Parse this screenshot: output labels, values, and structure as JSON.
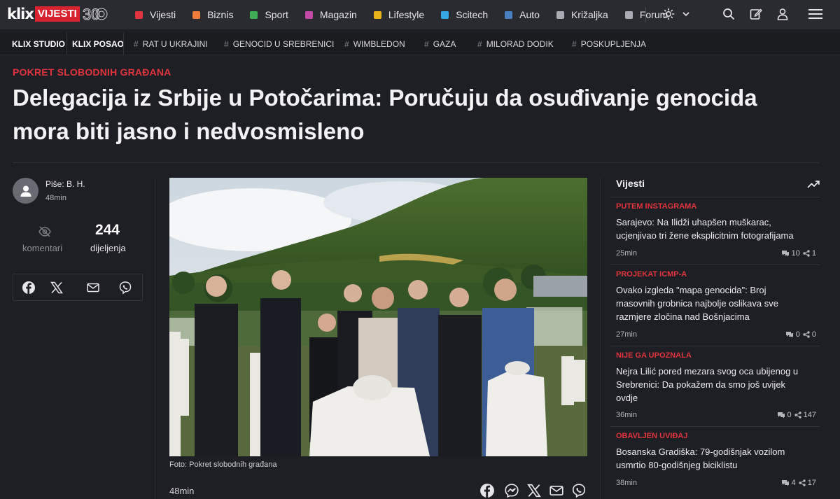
{
  "brand": {
    "logo_text": "klix",
    "section_badge": "VIJESTI",
    "anniversary": "30"
  },
  "nav": {
    "categories": [
      {
        "label": "Vijesti",
        "color": "#e0343e"
      },
      {
        "label": "Biznis",
        "color": "#f07c3b"
      },
      {
        "label": "Sport",
        "color": "#3fae55"
      },
      {
        "label": "Magazin",
        "color": "#c04aa6"
      },
      {
        "label": "Lifestyle",
        "color": "#e8b41a"
      },
      {
        "label": "Scitech",
        "color": "#35a6e6"
      },
      {
        "label": "Auto",
        "color": "#4a7fc1"
      },
      {
        "label": "Križaljka",
        "color": "#a9abb3"
      },
      {
        "label": "Forum",
        "color": "#a9abb3"
      }
    ]
  },
  "tagbar": {
    "primary": [
      "KLIX STUDIO",
      "KLIX POSAO"
    ],
    "tags": [
      "RAT U UKRAJINI",
      "GENOCID U SREBRENICI",
      "WIMBLEDON",
      "GAZA",
      "MILORAD DODIK",
      "POSKUPLJENJA"
    ]
  },
  "article": {
    "kicker": "POKRET SLOBODNIH GRAĐANA",
    "headline_line1": "Delegacija iz Srbije u Potočarima: Poručuju da osuđivanje genocida",
    "headline_line2": "mora biti jasno i nedvosmisleno",
    "author": "Piše: B. H.",
    "time": "48min",
    "comments_label": "komentari",
    "shares_count": "244",
    "shares_label": "dijeljenja",
    "photo_caption": "Foto: Pokret slobodnih građana",
    "footer_time": "48min"
  },
  "sidebar": {
    "title": "Vijesti",
    "items": [
      {
        "kicker": "PUTEM INSTAGRAMA",
        "line1": "Sarajevo: Na Ilidži uhapšen muškarac,",
        "line2": "ucjenjivao tri žene eksplicitnim fotografijama",
        "line3": "",
        "time": "25min",
        "comments": "10",
        "shares": "1"
      },
      {
        "kicker": "PROJEKAT ICMP-A",
        "line1": "Ovako izgleda \"mapa genocida\": Broj",
        "line2": "masovnih grobnica najbolje oslikava sve",
        "line3": "razmjere zločina nad Bošnjacima",
        "time": "27min",
        "comments": "0",
        "shares": "0"
      },
      {
        "kicker": "NIJE GA UPOZNALA",
        "line1": "Nejra Lilić pored mezara svog oca ubijenog u",
        "line2": "Srebrenici: Da pokažem da smo još uvijek",
        "line3": "ovdje",
        "time": "36min",
        "comments": "0",
        "shares": "147"
      },
      {
        "kicker": "OBAVLJEN UVIĐAJ",
        "line1": "Bosanska Gradiška: 79-godišnjak vozilom",
        "line2": "usmrtio 80-godišnjeg biciklistu",
        "line3": "",
        "time": "38min",
        "comments": "4",
        "shares": "17"
      }
    ]
  }
}
